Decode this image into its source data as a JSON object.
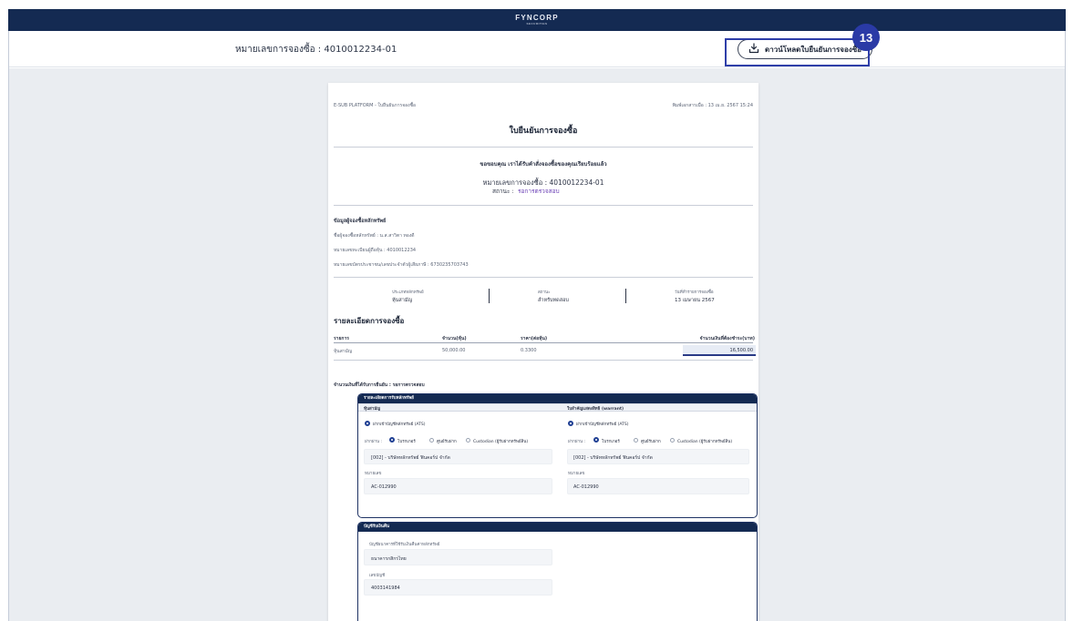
{
  "app": {
    "logo": "FYNCORP",
    "logo_sub": "SECURITIES"
  },
  "header": {
    "order_label": "หมายเลขการจองซื้อ : 4010012234-01",
    "download_label": "ดาวน์โหลดใบยืนยันการจองซื้อ",
    "step_number": "13"
  },
  "doc": {
    "platform": "E-SUB PLATFORM - ใบยืนยันการจองซื้อ",
    "printed_at": "พิมพ์เอกสารเมื่อ : 13 เม.ย. 2567 15:24",
    "title": "ใบยืนยันการจองซื้อ",
    "thank_you": "ขอขอบคุณ เราได้รับคำสั่งจองซื้อของคุณเรียบร้อยแล้ว",
    "order_no": "หมายเลขการจองซื้อ : 4010012234-01",
    "status_label": "สถานะ :",
    "status_value": "รอการตรวจสอบ",
    "subscriber": {
      "heading": "ข้อมูลผู้จองซื้อหลักทรัพย์",
      "name": "ชื่อผู้จองซื้อหลักทรัพย์ : น.ส.สาวิตา ทองดี",
      "shareholder_reg": "หมายเลขทะเบียนผู้ถือหุ้น : 4010012234",
      "id_no": "หมายเลขบัตรประชาชน/เลขประจำตัวผู้เสียภาษี : 6730235703743"
    },
    "summary": [
      {
        "label": "ประเภทหลักทรัพย์",
        "value": "หุ้นสามัญ"
      },
      {
        "label": "สถานะ",
        "value": "สำหรับทดสอบ"
      },
      {
        "label": "วันที่ทำรายการจองซื้อ",
        "value": "13 เมษายน 2567"
      }
    ],
    "details_heading": "รายละเอียดการจองซื้อ",
    "table": {
      "headers": [
        "รายการ",
        "จำนวน(หุ้น)",
        "ราคา(ต่อหุ้น)",
        "จำนวนเงินที่ต้องชำระ(บาท)"
      ],
      "row": [
        "หุ้นสามัญ",
        "50,000.00",
        "0.3300",
        "16,500.00"
      ]
    },
    "refund_note": "จำนวนเงินที่ได้รับการยืนยัน : รอการตรวจสอบ",
    "delivery_panel": {
      "title": "รายละเอียดการรับหลักทรัพย์",
      "left_col": "หุ้นสามัญ",
      "right_col": "ใบสำคัญแสดงสิทธิ (warrant)",
      "deposit_option": "ฝากเข้าบัญชีหลักทรัพย์ (ATS)",
      "options": [
        "โบรกเกอร์",
        "ศูนย์รับฝาก",
        "Custodian (ผู้รับฝากทรัพย์สิน)"
      ],
      "broker_left": "[002] - บริษัทหลักทรัพย์ ฟินคอร์ป จำกัด",
      "broker_right": "[002] - บริษัทหลักทรัพย์ ฟินคอร์ป จำกัด",
      "account_label": "หมายเลข",
      "account_left": "AC-012990",
      "account_right": "AC-012990",
      "via_label": "ฝากผ่าน :"
    },
    "bank_panel": {
      "title": "บัญชีรับเงินคืน",
      "bank_label": "บัญชีธนาคารที่ใช้รับเงินคืนค่าหลักทรัพย์",
      "bank_value": "ธนาคารกสิกรไทย",
      "acct_label": "เลขบัญชี",
      "acct_value": "4003141984"
    }
  }
}
